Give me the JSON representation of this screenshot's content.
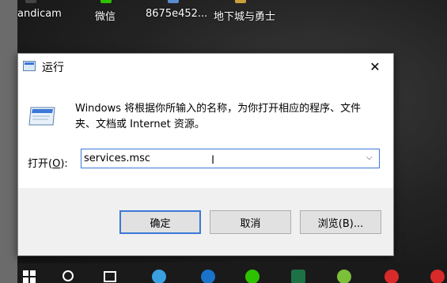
{
  "desktop": {
    "icons": [
      {
        "label": "andicam",
        "color": "#444444"
      },
      {
        "label": "微信",
        "color": "#2dc100"
      },
      {
        "label": "8675e452...",
        "color": "#5b8bd0"
      },
      {
        "label": "地下城与勇士",
        "color": "#c9a13a"
      }
    ]
  },
  "dialog": {
    "title": "运行",
    "close_symbol": "✕",
    "description": "Windows 将根据你所输入的名称，为你打开相应的程序、文件夹、文档或 Internet 资源。",
    "open_label_prefix": "打开(",
    "open_label_key": "O",
    "open_label_suffix": "):",
    "command_value": "services.msc",
    "dropdown_symbol": "⌵",
    "buttons": {
      "ok": "确定",
      "cancel": "取消",
      "browse": "浏览(B)..."
    }
  },
  "taskbar": {
    "icons": [
      {
        "name": "start-icon",
        "color": "#ffffff"
      },
      {
        "name": "search-icon",
        "color": "#ffffff"
      },
      {
        "name": "task-view-icon",
        "color": "#ffffff"
      },
      {
        "name": "app-icon",
        "color": "#3aa0e0"
      },
      {
        "name": "edge-icon",
        "color": "#1a73c8"
      },
      {
        "name": "wechat-icon",
        "color": "#2dc100"
      },
      {
        "name": "excel-icon",
        "color": "#1e7145"
      },
      {
        "name": "game-icon",
        "color": "#7bbf3a"
      },
      {
        "name": "netease-music-icon",
        "color": "#d82a2a"
      },
      {
        "name": "record-icon",
        "color": "#d82a2a"
      }
    ]
  },
  "colors": {
    "accent": "#3c78d8",
    "dialog_bg": "#f0f0f0",
    "taskbar_bg": "#1a1a1a"
  }
}
